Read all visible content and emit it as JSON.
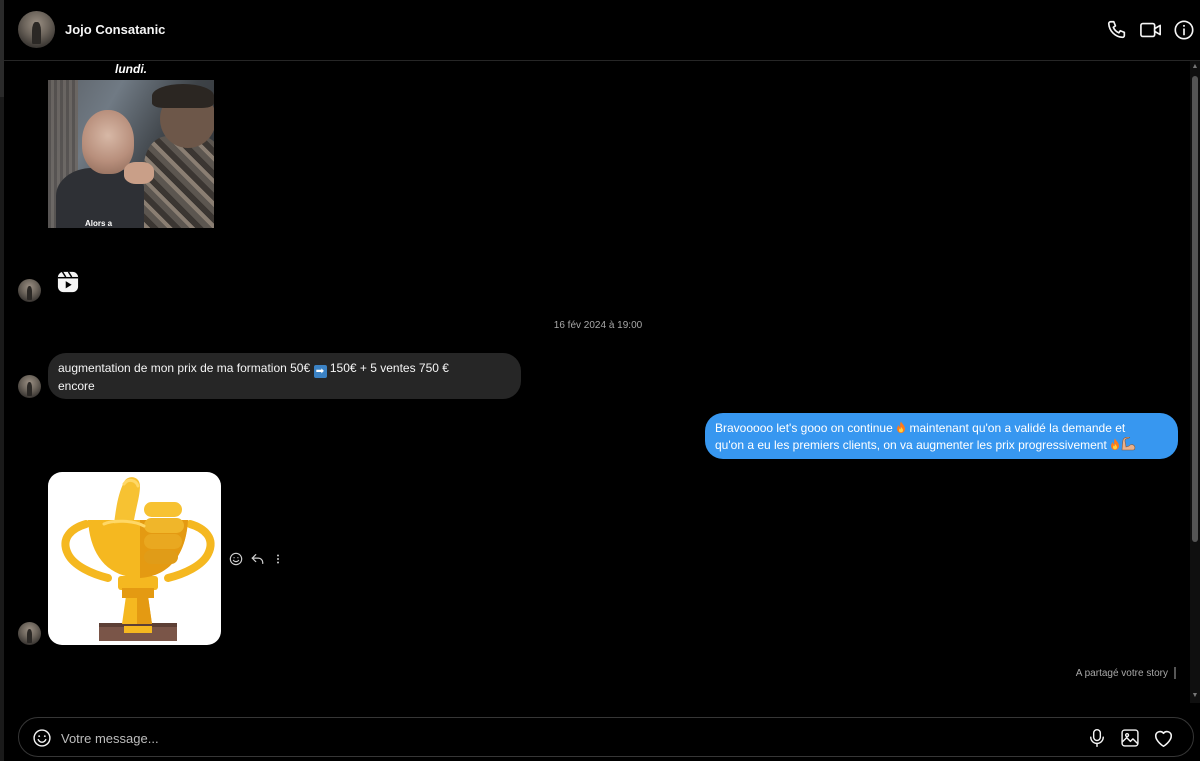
{
  "header": {
    "contact_name": "Jojo Consatanic",
    "icons": [
      "phone-icon",
      "video-camera-icon",
      "info-icon"
    ]
  },
  "conversation": {
    "gif": {
      "caption_top": "lundi.",
      "caption_bottom": "Alors a"
    },
    "timestamp": "16 fév 2024 à 19:00",
    "incoming_message": {
      "text_before": "augmentation de mon prix de ma formation 50€",
      "text_after": "150€ + 5 ventes 750 €",
      "text_line2": "encore",
      "emoji": "➡"
    },
    "outgoing_message": {
      "text_before": "Bravooooo let's gooo on continue",
      "text_after": "maintenant qu'on a validé la demande et",
      "text_line2": "qu'on a eu les premiers clients, on va augmenter les prix progressivement"
    },
    "sticker": "thumbs-up-trophy-sticker",
    "story_note": "A partagé votre story"
  },
  "composer": {
    "placeholder": "Votre message..."
  },
  "colors": {
    "background": "#000000",
    "incoming_bubble": "#262626",
    "outgoing_bubble": "#3797f0",
    "trophy_gold": "#f5b820"
  }
}
